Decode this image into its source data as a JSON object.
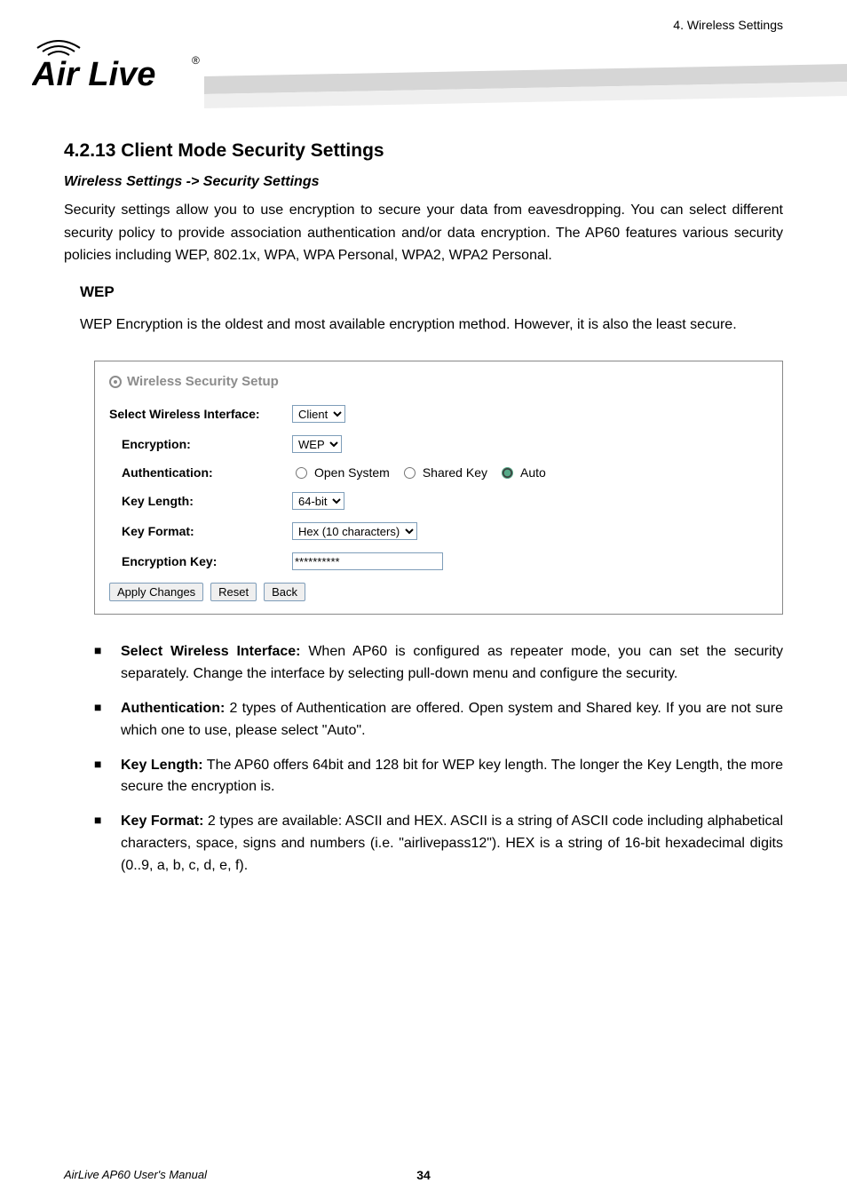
{
  "header": {
    "right_text": "4. Wireless Settings",
    "logo_text": "Air Live",
    "logo_sup": "®"
  },
  "section": {
    "title": "4.2.13 Client Mode Security Settings",
    "subhead": "Wireless Settings -> Security Settings",
    "paragraph": "Security settings allow you to use encryption to secure your data from eavesdropping.  You can select different security policy to provide association authentication and/or data encryption.    The AP60 features various security policies including WEP, 802.1x, WPA, WPA Personal, WPA2, WPA2 Personal."
  },
  "wep": {
    "title": "WEP",
    "desc": "WEP Encryption is the oldest and most available encryption method.    However, it is also the least secure."
  },
  "panel": {
    "title": "Wireless Security Setup",
    "select_iface_label": "Select Wireless Interface:",
    "select_iface_value": "Client",
    "encryption_label": "Encryption:",
    "encryption_value": "WEP",
    "auth_label": "Authentication:",
    "auth_opts": {
      "open": "Open System",
      "shared": "Shared Key",
      "auto": "Auto"
    },
    "keylen_label": "Key Length:",
    "keylen_value": "64-bit",
    "keyfmt_label": "Key Format:",
    "keyfmt_value": "Hex (10 characters)",
    "enckey_label": "Encryption Key:",
    "enckey_value": "**********",
    "btn_apply": "Apply Changes",
    "btn_reset": "Reset",
    "btn_back": "Back"
  },
  "bullets": {
    "b1_bold": "Select Wireless Interface:",
    "b1_rest": "    When AP60 is configured as repeater mode, you can set the security separately. Change the interface by selecting pull-down menu and configure the security.",
    "b2_bold": "Authentication:",
    "b2_rest": "    2 types of Authentication are offered.    Open system and Shared key.    If you are not sure which one to use, please select \"Auto\".",
    "b3_bold": "Key Length:",
    "b3_rest": "    The AP60 offers 64bit and 128 bit for WEP key length.    The longer the Key Length, the more secure the encryption is.",
    "b4_bold": "Key Format:",
    "b4_rest": "    2 types are available: ASCII and HEX.    ASCII is a string of ASCII code including alphabetical characters, space, signs and numbers (i.e. \"airlivepass12\").    HEX is a string of 16-bit hexadecimal digits (0..9, a, b, c, d, e, f)."
  },
  "footer": {
    "title": "AirLive AP60 User's Manual",
    "page": "34"
  }
}
